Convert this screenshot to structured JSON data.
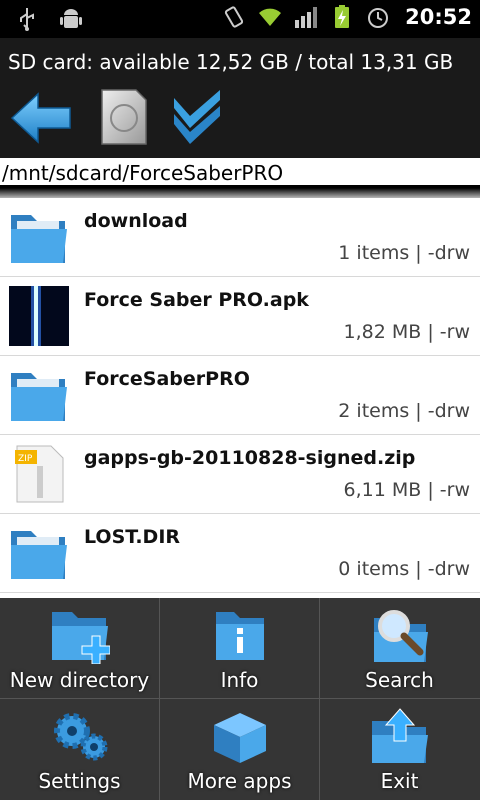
{
  "status_bar": {
    "time": "20:52",
    "icons": [
      "usb-icon",
      "android-debug-icon",
      "vibrate-icon",
      "wifi-icon",
      "signal-icon",
      "battery-charging-icon",
      "alarm-icon"
    ]
  },
  "header": {
    "storage_info": "SD card: available 12,52 GB / total 13,31 GB",
    "toolbar": [
      "back-arrow-icon",
      "sd-card-icon",
      "multi-select-check-icon"
    ]
  },
  "path": "/mnt/sdcard/ForceSaberPRO",
  "files": [
    {
      "name": "download",
      "meta": "1 items | -drw",
      "icon": "folder-icon"
    },
    {
      "name": "Force Saber PRO.apk",
      "meta": "1,82 MB  | -rw",
      "icon": "apk-thumbnail-icon"
    },
    {
      "name": "ForceSaberPRO",
      "meta": "2 items | -drw",
      "icon": "folder-icon"
    },
    {
      "name": "gapps-gb-20110828-signed.zip",
      "meta": "6,11 MB  | -rw",
      "icon": "zip-file-icon"
    },
    {
      "name": "LOST.DIR",
      "meta": "0 items | -drw",
      "icon": "folder-icon"
    }
  ],
  "menu": {
    "items": [
      {
        "label": "New directory",
        "icon": "new-folder-icon"
      },
      {
        "label": "Info",
        "icon": "info-icon"
      },
      {
        "label": "Search",
        "icon": "search-icon"
      },
      {
        "label": "Settings",
        "icon": "gears-icon"
      },
      {
        "label": "More apps",
        "icon": "box-icon"
      },
      {
        "label": "Exit",
        "icon": "exit-folder-icon"
      }
    ]
  },
  "colors": {
    "accent": "#2a93d5",
    "header_bg": "#1a1a1a",
    "menu_bg": "#141414"
  }
}
